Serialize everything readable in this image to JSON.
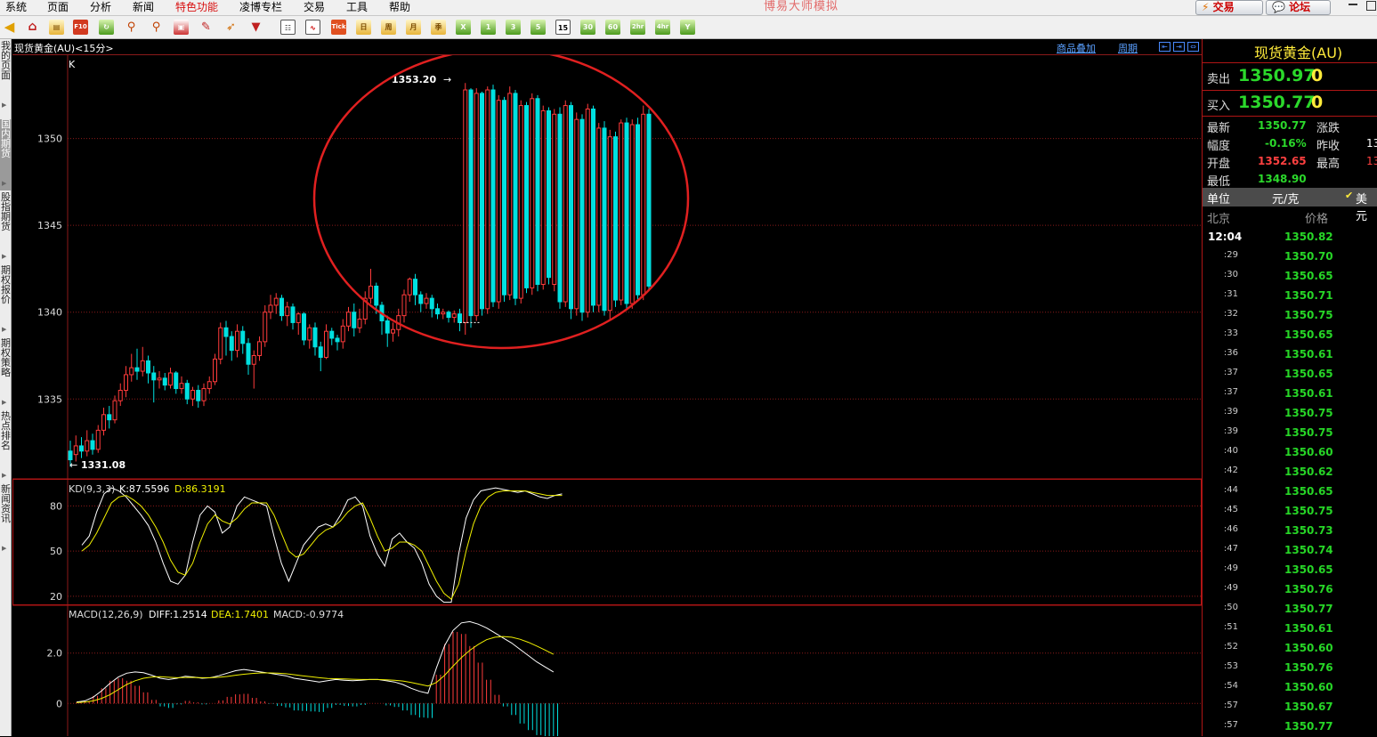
{
  "menu": [
    "系统",
    "页面",
    "分析",
    "新闻",
    "特色功能",
    "凌博专栏",
    "交易",
    "工具",
    "帮助"
  ],
  "app_title": "博易大师模拟",
  "top_buttons": {
    "trade": "交易",
    "forum": "论坛"
  },
  "toolbar": {
    "period_buttons": [
      "Tick",
      "日",
      "周",
      "月",
      "季",
      "X",
      "1",
      "3",
      "5",
      "15",
      "30",
      "60",
      "2hr",
      "4hr",
      "Y"
    ],
    "selected": "15"
  },
  "sidebar_tabs": [
    "我的页面",
    "国内期货",
    "股指期货",
    "期权报价",
    "期权策略",
    "热点排名",
    "新闻资讯"
  ],
  "chart": {
    "symbol_label": "现货黄金(AU)<15分>",
    "links": {
      "overlay": "商品叠加",
      "period": "周期"
    },
    "main_label": "K",
    "max_label": "1353.20",
    "min_label": "1331.08",
    "kd_label": "KD(9,3,3)",
    "kd_k": "K:87.5596",
    "kd_d": "D:86.3191",
    "macd_label": "MACD(12,26,9)",
    "macd_diff": "DIFF:1.2514",
    "macd_dea": "DEA:1.7401",
    "macd_macd": "MACD:-0.9774",
    "colors": {
      "up": "#ff3b3b",
      "down": "#00e0e0",
      "k_line": "#ffffff",
      "d_line": "#f0f000",
      "grid": "#8b1a1a",
      "circle": "#e02020"
    }
  },
  "chart_data": [
    {
      "type": "candlestick",
      "title": "",
      "yticks": [
        1335,
        1340,
        1345,
        1350
      ],
      "ylim": [
        1330.4,
        1354.8
      ],
      "candles": [
        [
          1332.0,
          1331.5,
          1332.6,
          1331.1
        ],
        [
          1331.8,
          1332.3,
          1332.9,
          1331.4
        ],
        [
          1332.3,
          1332.0,
          1332.8,
          1331.6
        ],
        [
          1332.0,
          1332.6,
          1333.2,
          1331.7
        ],
        [
          1332.6,
          1332.1,
          1333.0,
          1331.8
        ],
        [
          1332.1,
          1333.2,
          1333.5,
          1331.9
        ],
        [
          1333.2,
          1334.1,
          1334.5,
          1332.9
        ],
        [
          1334.1,
          1333.8,
          1334.6,
          1333.3
        ],
        [
          1333.8,
          1334.9,
          1335.2,
          1333.6
        ],
        [
          1334.9,
          1335.5,
          1335.9,
          1334.6
        ],
        [
          1335.5,
          1336.4,
          1336.9,
          1335.1
        ],
        [
          1336.4,
          1336.8,
          1337.6,
          1336.0
        ],
        [
          1336.8,
          1336.6,
          1337.9,
          1336.1
        ],
        [
          1336.6,
          1337.2,
          1338.0,
          1336.3
        ],
        [
          1337.2,
          1336.5,
          1337.5,
          1335.9
        ],
        [
          1336.5,
          1336.1,
          1336.9,
          1334.8
        ],
        [
          1336.1,
          1336.2,
          1336.6,
          1335.6
        ],
        [
          1336.2,
          1335.8,
          1336.5,
          1335.5
        ],
        [
          1335.8,
          1336.5,
          1336.8,
          1335.6
        ],
        [
          1336.5,
          1335.6,
          1336.6,
          1335.3
        ],
        [
          1335.6,
          1335.9,
          1336.3,
          1335.3
        ],
        [
          1335.9,
          1335.0,
          1336.1,
          1334.7
        ],
        [
          1335.0,
          1335.5,
          1335.7,
          1334.6
        ],
        [
          1335.5,
          1334.9,
          1335.8,
          1334.5
        ],
        [
          1334.9,
          1335.6,
          1335.9,
          1334.6
        ],
        [
          1335.6,
          1336.0,
          1336.3,
          1335.3
        ],
        [
          1336.0,
          1337.3,
          1337.6,
          1335.8
        ],
        [
          1337.3,
          1339.1,
          1339.4,
          1337.0
        ],
        [
          1339.1,
          1338.6,
          1339.5,
          1337.5
        ],
        [
          1338.6,
          1337.8,
          1338.9,
          1337.2
        ],
        [
          1337.8,
          1338.9,
          1339.3,
          1337.4
        ],
        [
          1338.9,
          1338.2,
          1339.2,
          1337.6
        ],
        [
          1338.2,
          1337.0,
          1338.5,
          1336.4
        ],
        [
          1337.0,
          1337.5,
          1337.8,
          1335.6
        ],
        [
          1337.5,
          1338.3,
          1338.6,
          1337.2
        ],
        [
          1338.3,
          1340.0,
          1340.4,
          1338.0
        ],
        [
          1340.0,
          1340.4,
          1341.0,
          1339.6
        ],
        [
          1340.4,
          1340.8,
          1341.1,
          1339.9
        ],
        [
          1340.8,
          1339.8,
          1341.0,
          1339.5
        ],
        [
          1339.8,
          1340.3,
          1340.6,
          1339.2
        ],
        [
          1340.3,
          1339.4,
          1340.5,
          1339.0
        ],
        [
          1339.4,
          1339.9,
          1340.0,
          1338.7
        ],
        [
          1339.9,
          1338.4,
          1340.0,
          1338.1
        ],
        [
          1338.4,
          1339.1,
          1339.3,
          1337.9
        ],
        [
          1339.1,
          1338.0,
          1339.4,
          1337.5
        ],
        [
          1338.0,
          1337.4,
          1338.3,
          1336.6
        ],
        [
          1337.4,
          1338.9,
          1339.3,
          1337.3
        ],
        [
          1338.9,
          1338.5,
          1339.1,
          1338.1
        ],
        [
          1338.5,
          1338.3,
          1338.7,
          1337.8
        ],
        [
          1338.3,
          1339.2,
          1339.6,
          1337.9
        ],
        [
          1339.2,
          1340.0,
          1340.3,
          1338.9
        ],
        [
          1340.0,
          1339.1,
          1340.5,
          1338.6
        ],
        [
          1339.1,
          1339.6,
          1340.2,
          1338.8
        ],
        [
          1339.6,
          1340.8,
          1341.2,
          1339.3
        ],
        [
          1340.8,
          1341.5,
          1342.5,
          1340.5
        ],
        [
          1341.5,
          1340.4,
          1341.7,
          1339.9
        ],
        [
          1340.4,
          1339.5,
          1340.6,
          1338.7
        ],
        [
          1339.5,
          1338.8,
          1339.8,
          1338.0
        ],
        [
          1338.8,
          1339.0,
          1339.4,
          1338.3
        ],
        [
          1339.0,
          1339.8,
          1340.2,
          1338.6
        ],
        [
          1339.8,
          1341.0,
          1341.3,
          1339.4
        ],
        [
          1341.0,
          1341.9,
          1342.0,
          1340.6
        ],
        [
          1341.9,
          1341.0,
          1342.2,
          1340.4
        ],
        [
          1341.0,
          1340.5,
          1341.2,
          1340.0
        ],
        [
          1340.5,
          1340.8,
          1341.1,
          1340.2
        ],
        [
          1340.8,
          1340.2,
          1341.0,
          1339.7
        ],
        [
          1340.2,
          1339.9,
          1340.5,
          1339.6
        ],
        [
          1339.9,
          1340.0,
          1340.2,
          1339.6
        ],
        [
          1340.0,
          1339.7,
          1340.1,
          1339.4
        ],
        [
          1339.7,
          1339.9,
          1340.1,
          1339.4
        ],
        [
          1339.9,
          1339.4,
          1340.2,
          1338.9
        ],
        [
          1339.4,
          1352.8,
          1353.2,
          1338.7
        ],
        [
          1352.8,
          1339.8,
          1352.9,
          1339.1
        ],
        [
          1339.8,
          1352.6,
          1352.9,
          1339.5
        ],
        [
          1352.6,
          1340.2,
          1352.7,
          1339.8
        ],
        [
          1340.2,
          1352.8,
          1353.0,
          1339.9
        ],
        [
          1352.8,
          1340.6,
          1353.1,
          1340.3
        ],
        [
          1340.6,
          1352.2,
          1352.5,
          1340.2
        ],
        [
          1352.2,
          1341.0,
          1352.4,
          1340.6
        ],
        [
          1341.0,
          1352.6,
          1353.0,
          1340.7
        ],
        [
          1352.6,
          1340.8,
          1352.8,
          1340.4
        ],
        [
          1340.8,
          1351.9,
          1352.2,
          1340.5
        ],
        [
          1351.9,
          1341.4,
          1352.1,
          1341.1
        ],
        [
          1341.4,
          1352.3,
          1352.6,
          1341.0
        ],
        [
          1352.3,
          1341.6,
          1352.5,
          1341.2
        ],
        [
          1341.6,
          1351.6,
          1351.9,
          1341.3
        ],
        [
          1351.6,
          1342.0,
          1351.8,
          1341.6
        ],
        [
          1341.6,
          1351.4,
          1351.7,
          1341.2
        ],
        [
          1351.4,
          1340.6,
          1351.8,
          1340.2
        ],
        [
          1340.6,
          1351.9,
          1352.2,
          1340.3
        ],
        [
          1351.9,
          1340.2,
          1352.1,
          1339.6
        ],
        [
          1340.2,
          1351.1,
          1351.5,
          1339.8
        ],
        [
          1351.1,
          1340.0,
          1351.4,
          1339.5
        ],
        [
          1340.0,
          1351.7,
          1352.0,
          1339.7
        ],
        [
          1351.7,
          1340.4,
          1351.9,
          1340.0
        ],
        [
          1340.4,
          1350.6,
          1350.9,
          1340.0
        ],
        [
          1350.6,
          1340.1,
          1351.0,
          1339.8
        ],
        [
          1340.1,
          1350.1,
          1350.5,
          1339.6
        ],
        [
          1350.1,
          1340.7,
          1350.4,
          1340.3
        ],
        [
          1340.7,
          1350.9,
          1351.1,
          1340.4
        ],
        [
          1350.9,
          1340.5,
          1351.2,
          1340.2
        ],
        [
          1340.5,
          1350.8,
          1351.1,
          1340.2
        ],
        [
          1350.8,
          1341.0,
          1351.2,
          1340.6
        ],
        [
          1341.0,
          1351.4,
          1351.9,
          1340.7
        ],
        [
          1351.4,
          1341.5,
          1351.7,
          1341.2
        ]
      ]
    },
    {
      "type": "line",
      "title": "KD(9,3,3)",
      "yticks": [
        20,
        50,
        80
      ],
      "ylim": [
        14,
        98
      ],
      "series": [
        {
          "name": "K",
          "values": [
            54,
            60,
            76,
            88,
            92,
            90,
            86,
            80,
            74,
            67,
            56,
            42,
            30,
            28,
            34,
            56,
            74,
            80,
            76,
            62,
            66,
            80,
            86,
            84,
            82,
            80,
            60,
            42,
            30,
            42,
            54,
            60,
            66,
            68,
            66,
            74,
            84,
            86,
            80,
            60,
            48,
            40,
            58,
            62,
            56,
            52,
            42,
            28,
            20,
            16,
            16,
            48,
            72,
            84,
            90,
            91,
            92,
            91,
            90,
            89,
            90,
            88,
            86,
            85,
            87,
            88
          ]
        },
        {
          "name": "D",
          "values": [
            50,
            54,
            62,
            72,
            82,
            86,
            87,
            84,
            80,
            74,
            66,
            56,
            44,
            36,
            34,
            42,
            56,
            68,
            74,
            70,
            68,
            72,
            78,
            82,
            82,
            82,
            74,
            62,
            50,
            46,
            48,
            54,
            60,
            64,
            66,
            70,
            76,
            80,
            82,
            72,
            60,
            50,
            52,
            56,
            56,
            54,
            50,
            40,
            30,
            22,
            18,
            28,
            50,
            68,
            80,
            86,
            89,
            90,
            90,
            90,
            90,
            89,
            88,
            87,
            87,
            87
          ]
        }
      ]
    },
    {
      "type": "line",
      "title": "MACD(12,26,9)",
      "yticks": [
        0,
        2.0
      ],
      "ylim": [
        -1.3,
        3.9
      ],
      "series": [
        {
          "name": "DIFF",
          "values": [
            0.05,
            0.1,
            0.25,
            0.5,
            0.8,
            1.05,
            1.2,
            1.25,
            1.22,
            1.12,
            1.0,
            0.95,
            1.0,
            1.08,
            1.05,
            1.0,
            1.02,
            1.1,
            1.2,
            1.3,
            1.35,
            1.3,
            1.25,
            1.2,
            1.15,
            1.1,
            1.0,
            0.95,
            0.9,
            0.85,
            0.9,
            0.95,
            0.92,
            0.9,
            0.92,
            0.95,
            0.95,
            0.9,
            0.85,
            0.75,
            0.6,
            0.48,
            0.4,
            1.4,
            2.3,
            2.9,
            3.2,
            3.25,
            3.15,
            3.0,
            2.8,
            2.6,
            2.4,
            2.15,
            1.9,
            1.65,
            1.45,
            1.25
          ]
        },
        {
          "name": "DEA",
          "values": [
            0.03,
            0.05,
            0.1,
            0.2,
            0.35,
            0.55,
            0.75,
            0.9,
            1.0,
            1.05,
            1.06,
            1.04,
            1.02,
            1.03,
            1.03,
            1.02,
            1.02,
            1.04,
            1.07,
            1.12,
            1.16,
            1.19,
            1.21,
            1.21,
            1.2,
            1.18,
            1.14,
            1.1,
            1.06,
            1.02,
            0.99,
            0.98,
            0.97,
            0.96,
            0.95,
            0.95,
            0.95,
            0.94,
            0.92,
            0.89,
            0.83,
            0.76,
            0.69,
            0.83,
            1.12,
            1.48,
            1.82,
            2.11,
            2.34,
            2.53,
            2.63,
            2.66,
            2.63,
            2.55,
            2.43,
            2.28,
            2.12,
            1.95
          ]
        },
        {
          "name": "MACD",
          "values": [
            0.04,
            0.1,
            0.3,
            0.6,
            0.9,
            1.0,
            0.9,
            0.7,
            0.44,
            0.14,
            -0.12,
            -0.18,
            -0.04,
            0.1,
            0.04,
            -0.04,
            0,
            0.12,
            0.26,
            0.36,
            0.38,
            0.22,
            0.08,
            -0.02,
            -0.1,
            -0.16,
            -0.28,
            -0.3,
            -0.32,
            -0.34,
            -0.18,
            -0.06,
            -0.1,
            -0.12,
            -0.06,
            0,
            0,
            -0.08,
            -0.14,
            -0.28,
            -0.46,
            -0.56,
            -0.58,
            1.14,
            2.36,
            2.84,
            2.76,
            2.28,
            1.62,
            0.94,
            0.34,
            -0.12,
            -0.46,
            -0.8,
            -1.06,
            -1.26,
            -1.34,
            -1.4
          ]
        }
      ]
    }
  ],
  "quote": {
    "title": "现货黄金(AU)",
    "sell_label": "卖出",
    "sell_price": "1350.97",
    "sell_vol": "0",
    "buy_label": "买入",
    "buy_price": "1350.77",
    "buy_vol": "0",
    "latest_label": "最新",
    "latest": "1350.77",
    "change_label": "涨跌",
    "range_label": "幅度",
    "range": "-0.16%",
    "prev_close_label": "昨收",
    "prev_close_trunc": "13",
    "open_label": "开盘",
    "open": "1352.65",
    "high_label": "最高",
    "high_trunc": "13",
    "low_label": "最低",
    "low": "1348.90",
    "unit_label": "单位",
    "unit": "元/克",
    "usd": "美元",
    "col_time": "北京",
    "col_price": "价格"
  },
  "ticks": [
    {
      "t": "12:04",
      "p": "1350.82"
    },
    {
      "t": ":29",
      "p": "1350.70"
    },
    {
      "t": ":30",
      "p": "1350.65"
    },
    {
      "t": ":31",
      "p": "1350.71"
    },
    {
      "t": ":32",
      "p": "1350.75"
    },
    {
      "t": ":33",
      "p": "1350.65"
    },
    {
      "t": ":36",
      "p": "1350.61"
    },
    {
      "t": ":37",
      "p": "1350.65"
    },
    {
      "t": ":37",
      "p": "1350.61"
    },
    {
      "t": ":39",
      "p": "1350.75"
    },
    {
      "t": ":39",
      "p": "1350.75"
    },
    {
      "t": ":40",
      "p": "1350.60"
    },
    {
      "t": ":42",
      "p": "1350.62"
    },
    {
      "t": ":44",
      "p": "1350.65"
    },
    {
      "t": ":45",
      "p": "1350.75"
    },
    {
      "t": ":46",
      "p": "1350.73"
    },
    {
      "t": ":47",
      "p": "1350.74"
    },
    {
      "t": ":49",
      "p": "1350.65"
    },
    {
      "t": ":49",
      "p": "1350.76"
    },
    {
      "t": ":50",
      "p": "1350.77"
    },
    {
      "t": ":51",
      "p": "1350.61"
    },
    {
      "t": ":52",
      "p": "1350.60"
    },
    {
      "t": ":53",
      "p": "1350.76"
    },
    {
      "t": ":54",
      "p": "1350.60"
    },
    {
      "t": ":57",
      "p": "1350.67"
    },
    {
      "t": ":57",
      "p": "1350.77"
    }
  ]
}
